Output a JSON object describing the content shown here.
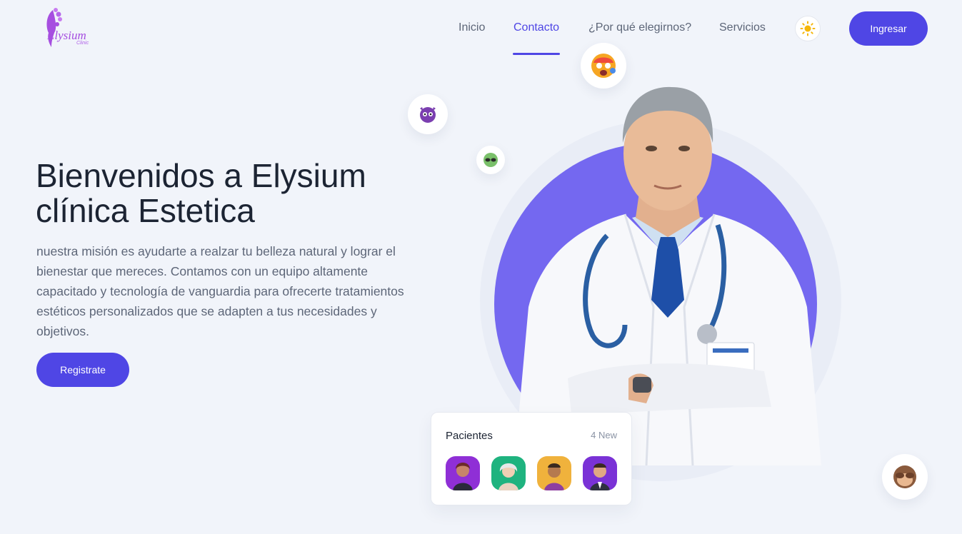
{
  "brand": {
    "name": "Elysium",
    "sub": "Clinic",
    "accent": "#a64ee0"
  },
  "nav": {
    "items": [
      {
        "label": "Inicio",
        "active": false
      },
      {
        "label": "Contacto",
        "active": true
      },
      {
        "label": "¿Por qué elegirnos?",
        "active": false
      },
      {
        "label": "Servicios",
        "active": false
      }
    ],
    "theme_icon": "sun-icon",
    "login_label": "Ingresar"
  },
  "hero": {
    "title_line1": "Bienvenidos a Elysium",
    "title_line2": "clínica Estetica",
    "description": "nuestra misión es ayudarte a realzar tu belleza natural y lograr el bienestar que mereces. Contamos con un equipo altamente capacitado y tecnología de vanguardia para ofrecerte tratamientos estéticos personalizados que se adapten a tus necesidades y objetivos.",
    "cta_label": "Registrate"
  },
  "patients_card": {
    "title": "Pacientes",
    "badge": "4 New",
    "avatars": [
      {
        "name": "patient-avatar-1",
        "bg": "#8f2fd6"
      },
      {
        "name": "patient-avatar-2",
        "bg": "#1fb37f"
      },
      {
        "name": "patient-avatar-3",
        "bg": "#f0b23c"
      },
      {
        "name": "patient-avatar-4",
        "bg": "#7a32d6"
      }
    ]
  },
  "floating_emojis": [
    "dizzy-face-emoji-icon",
    "devil-emoji-icon",
    "alien-emoji-icon",
    "monkey-emoji-icon"
  ],
  "colors": {
    "primary": "#4f46e5",
    "circle": "#7468f0",
    "background": "#f1f4fa"
  }
}
